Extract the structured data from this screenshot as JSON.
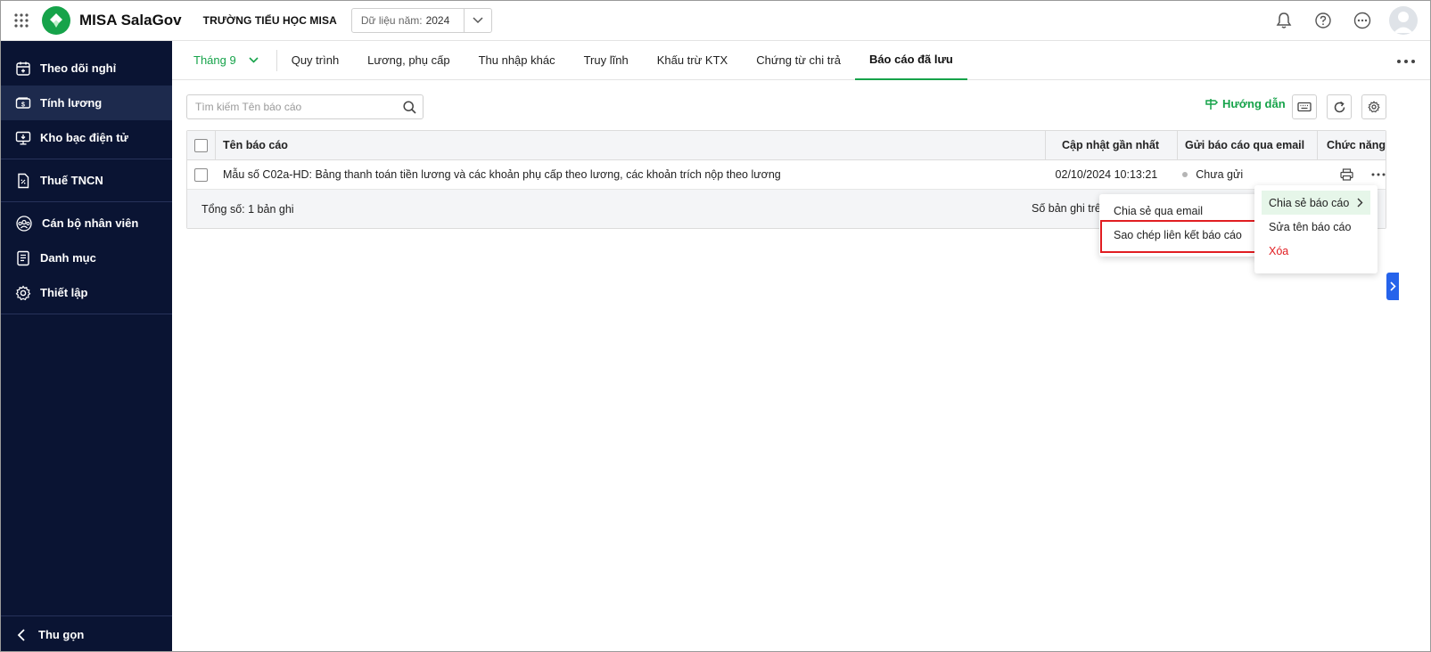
{
  "app": {
    "name": "MISA SalaGov",
    "org": "TRƯỜNG TIỂU HỌC MISA",
    "year_label": "Dữ liệu năm:",
    "year_value": "2024"
  },
  "sidebar": {
    "items": [
      {
        "label": "Theo dõi nghỉ",
        "icon": "calendar-icon"
      },
      {
        "label": "Tính lương",
        "icon": "money-icon",
        "active": true
      },
      {
        "label": "Kho bạc điện tử",
        "icon": "monitor-icon"
      },
      {
        "label": "Thuế TNCN",
        "icon": "tax-document-icon"
      },
      {
        "label": "Cán bộ nhân viên",
        "icon": "people-icon"
      },
      {
        "label": "Danh mục",
        "icon": "list-doc-icon"
      },
      {
        "label": "Thiết lập",
        "icon": "gear-icon"
      }
    ],
    "collapse_label": "Thu gọn"
  },
  "tabs": {
    "month": "Tháng 9",
    "items": [
      "Quy trình",
      "Lương, phụ cấp",
      "Thu nhập khác",
      "Truy lĩnh",
      "Khấu trừ KTX",
      "Chứng từ chi trả",
      "Báo cáo đã lưu"
    ],
    "active_index": 6
  },
  "toolbar": {
    "search_placeholder": "Tìm kiếm Tên báo cáo",
    "guide_label": "Hướng dẫn"
  },
  "table": {
    "headers": {
      "name": "Tên báo cáo",
      "updated": "Cập nhật gần nhất",
      "email": "Gửi báo cáo qua email",
      "func": "Chức năng"
    },
    "rows": [
      {
        "name": "Mẫu số C02a-HD: Bảng thanh toán tiền lương và các khoản phụ cấp theo lương, các khoản trích nộp theo lương",
        "updated": "02/10/2024 10:13:21",
        "status": "Chưa gửi"
      }
    ],
    "footer_total": "Tổng số: 1 bản ghi",
    "footer_right": "Số bản ghi trê"
  },
  "context_menu": {
    "items": [
      {
        "label": "Chia sẻ báo cáo",
        "active": true
      },
      {
        "label": "Sửa tên báo cáo"
      },
      {
        "label": "Xóa",
        "danger": true
      }
    ]
  },
  "share_submenu": {
    "items": [
      "Chia sẻ qua email",
      "Sao chép liên kết báo cáo"
    ],
    "highlight_index": 1
  },
  "colors": {
    "accent": "#16a34a",
    "sidebar_bg": "#0a1433",
    "danger": "#e11d21",
    "edge_tab": "#2563eb"
  }
}
